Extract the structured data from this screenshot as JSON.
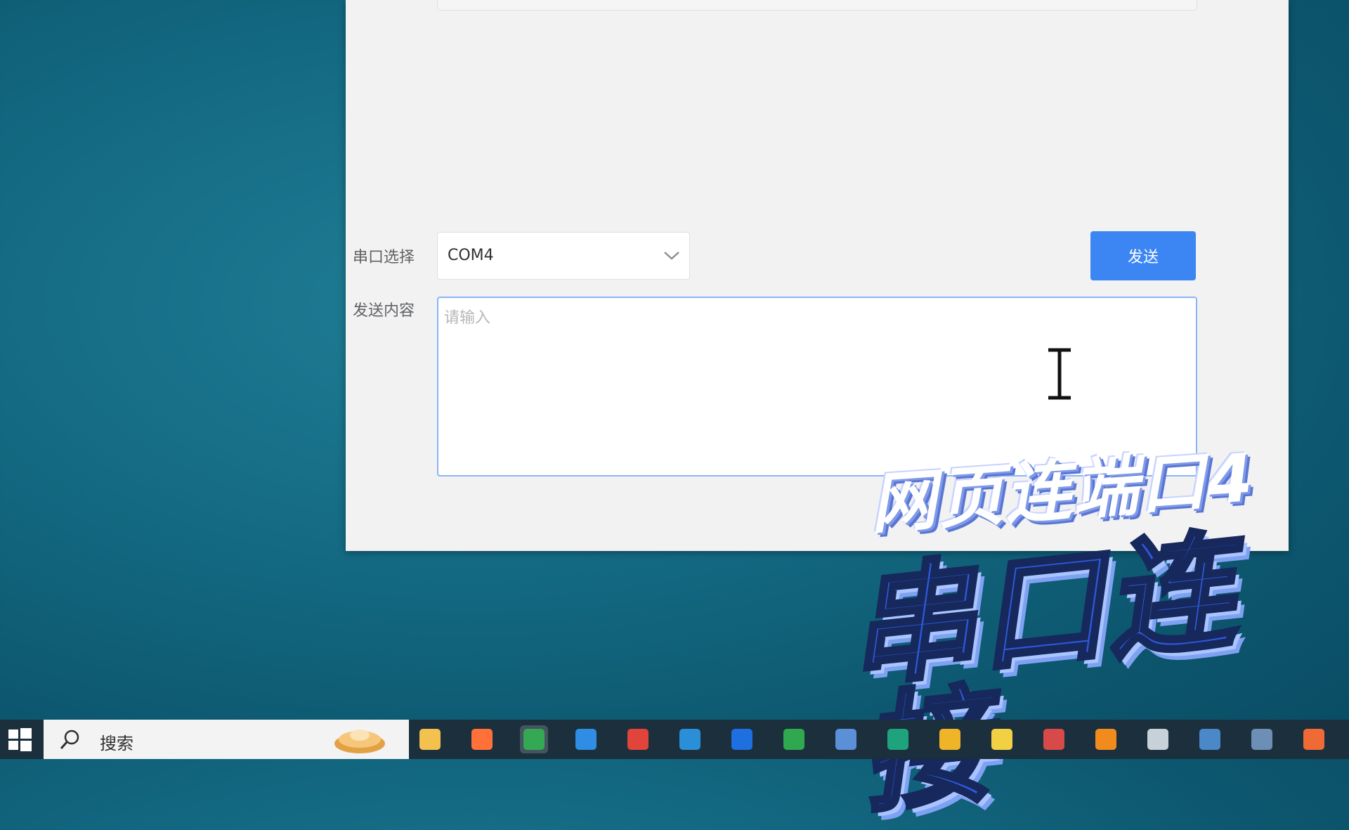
{
  "form": {
    "port_label": "串口选择",
    "port_value": "COM4",
    "send_button_label": "发送",
    "content_label": "发送内容",
    "content_placeholder": "请输入",
    "content_value": ""
  },
  "overlay": {
    "caption_small": "网页连端口4",
    "caption_large": "串口连接"
  },
  "taskbar": {
    "search_text": "搜索",
    "icons": [
      {
        "name": "file-explorer-icon",
        "color": "#f2c14e"
      },
      {
        "name": "firefox-icon",
        "color": "#ff7139"
      },
      {
        "name": "chrome-icon",
        "color": "#34a853"
      },
      {
        "name": "vscode-icon",
        "color": "#2f8de4"
      },
      {
        "name": "app-red-icon",
        "color": "#e0443a"
      },
      {
        "name": "edge-icon",
        "color": "#2a8fd6"
      },
      {
        "name": "app-blue-icon",
        "color": "#1e6fe0"
      },
      {
        "name": "app-green-icon",
        "color": "#2fa84f"
      },
      {
        "name": "remote-desktop-icon",
        "color": "#5b8fd8"
      },
      {
        "name": "app-teal-icon",
        "color": "#1fa37c"
      },
      {
        "name": "app-emoji-icon",
        "color": "#f0b429"
      },
      {
        "name": "app-yellow-icon",
        "color": "#f2d044"
      },
      {
        "name": "app-ball-icon",
        "color": "#d84a4a"
      },
      {
        "name": "app-orange-icon",
        "color": "#f28b1e"
      },
      {
        "name": "app-dots-icon",
        "color": "#c8d0d8"
      },
      {
        "name": "app-globe-icon",
        "color": "#4a88c8"
      },
      {
        "name": "app-folder-icon",
        "color": "#6d8fb5"
      },
      {
        "name": "app-orange-round-icon",
        "color": "#f06a35"
      }
    ]
  }
}
